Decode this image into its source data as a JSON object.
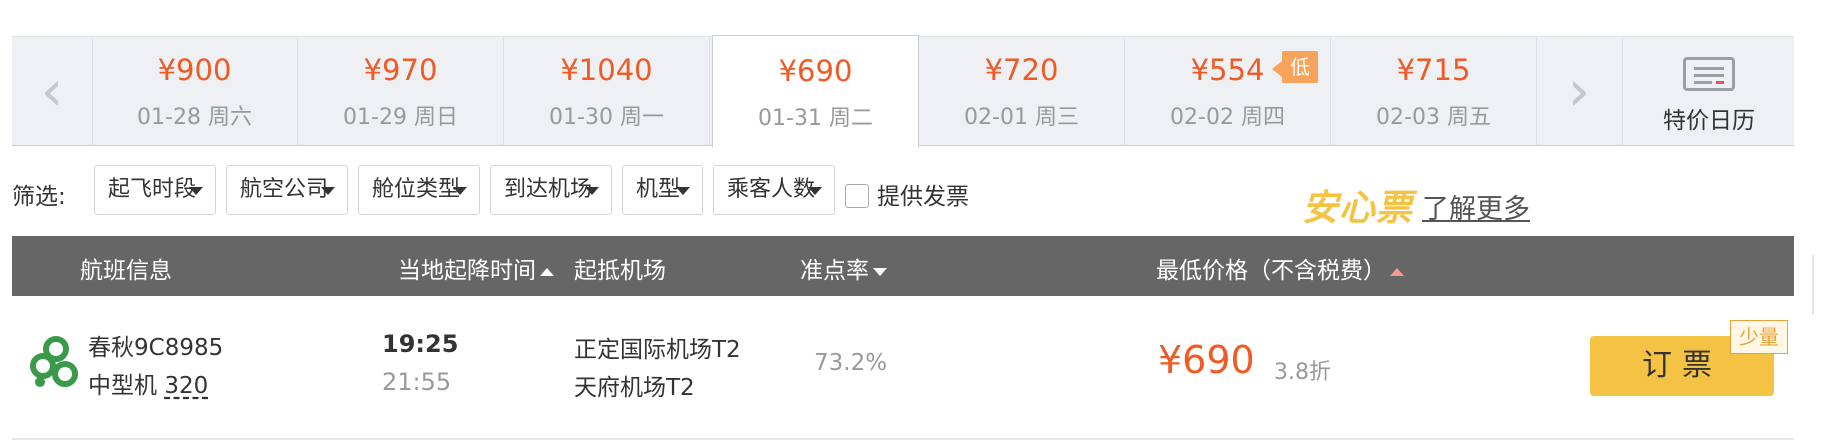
{
  "date_strip": {
    "prev_arrow": "‹",
    "next_arrow": "›",
    "days": [
      {
        "price": "¥900",
        "date": "01-28 周六"
      },
      {
        "price": "¥970",
        "date": "01-29 周日"
      },
      {
        "price": "¥1040",
        "date": "01-30 周一"
      },
      {
        "price": "¥690",
        "date": "01-31 周二",
        "selected": true
      },
      {
        "price": "¥720",
        "date": "02-01 周三"
      },
      {
        "price": "¥554",
        "date": "02-02 周四",
        "badge": "低"
      },
      {
        "price": "¥715",
        "date": "02-03 周五"
      }
    ],
    "calendar_label": "特价日历"
  },
  "filters": {
    "label": "筛选:",
    "options": [
      "起飞时段",
      "航空公司",
      "舱位类型",
      "到达机场",
      "机型",
      "乘客人数"
    ],
    "invoice_label": "提供发票",
    "anxin_label": "安心票",
    "learn_more": "了解更多"
  },
  "table_header": {
    "flight_info": "航班信息",
    "local_time": "当地起降时间",
    "airports": "起抵机场",
    "ontime_rate": "准点率",
    "lowest_price": "最低价格（不含税费）"
  },
  "flight": {
    "airline_flight": "春秋9C8985",
    "aircraft_size": "中型机",
    "aircraft_model": "320",
    "dep_time": "19:25",
    "arr_time": "21:55",
    "dep_airport": "正定国际机场T2",
    "arr_airport": "天府机场T2",
    "ontime_rate": "73.2%",
    "price": "¥690",
    "discount": "3.8折",
    "book_label": "订票",
    "few_left": "少量"
  },
  "colors": {
    "price_red": "#f05a24",
    "header_gray": "#666666",
    "book_yellow": "#f5c343",
    "low_badge": "#f7a35c",
    "airline_green": "#3a9a4a"
  }
}
